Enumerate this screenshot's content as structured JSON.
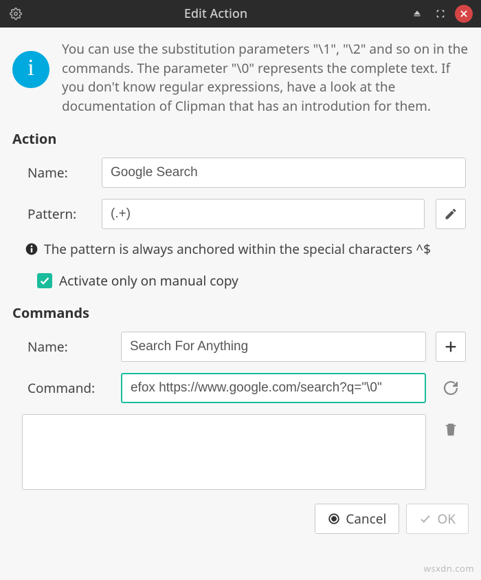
{
  "titlebar": {
    "title": "Edit Action"
  },
  "info": {
    "text": "You can use the substitution parameters \"\\1\", \"\\2\" and so on in the commands. The parameter \"\\0\" represents the complete text. If you don't know regular expressions, have a look at the documentation of Clipman that has an introdution for them."
  },
  "action": {
    "header": "Action",
    "name_label": "Name:",
    "name_value": "Google Search",
    "pattern_label": "Pattern:",
    "pattern_value": "(.+)",
    "pattern_hint": "The pattern is always anchored within the special characters ^$",
    "activate_label": "Activate only on manual copy",
    "activate_checked": true
  },
  "commands": {
    "header": "Commands",
    "name_label": "Name:",
    "name_value": "Search For Anything",
    "command_label": "Command:",
    "command_value": "efox https://www.google.com/search?q=\"\\0\""
  },
  "buttons": {
    "cancel": "Cancel",
    "ok": "OK"
  },
  "watermark": "wsxdn.com"
}
